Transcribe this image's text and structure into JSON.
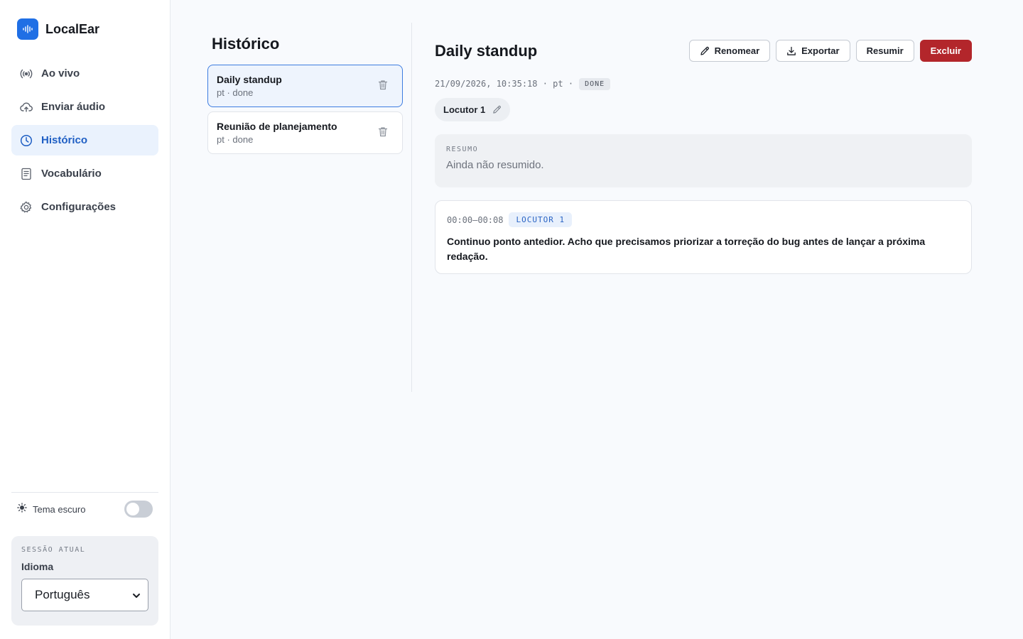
{
  "app": {
    "name": "LocalEar",
    "logo_icon": "waveform-icon",
    "accent": "#1f6fe5"
  },
  "nav": {
    "items": [
      {
        "label": "Ao vivo",
        "icon": "broadcast-icon",
        "active": false
      },
      {
        "label": "Enviar áudio",
        "icon": "cloud-upload-icon",
        "active": false
      },
      {
        "label": "Histórico",
        "icon": "clock-icon",
        "active": true
      },
      {
        "label": "Vocabulário",
        "icon": "book-list-icon",
        "active": false
      },
      {
        "label": "Configurações",
        "icon": "gear-icon",
        "active": false
      }
    ]
  },
  "theme": {
    "label": "Tema escuro",
    "icon": "sun-icon",
    "enabled": false
  },
  "session": {
    "caption": "SESSÃO ATUAL",
    "language_label": "Idioma",
    "language_value": "Português"
  },
  "history": {
    "title": "Histórico",
    "items": [
      {
        "title": "Daily standup",
        "meta": "pt · done",
        "selected": true
      },
      {
        "title": "Reunião de planejamento",
        "meta": "pt · done",
        "selected": false
      }
    ]
  },
  "detail": {
    "title": "Daily standup",
    "buttons": {
      "rename": "Renomear",
      "export": "Exportar",
      "summarize": "Resumir",
      "delete": "Excluir"
    },
    "meta": "21/09/2026, 10:35:18 · pt ·",
    "status": "DONE",
    "speaker_chip": "Locutor 1",
    "summary": {
      "caption": "RESUMO",
      "text": "Ainda não resumido."
    },
    "segments": [
      {
        "time": "00:00–00:08",
        "speaker": "LOCUTOR 1",
        "text": "Continuo ponto antedior. Acho que precisamos priorizar a torreção do bug antes de lançar a próxima redação."
      }
    ]
  },
  "colors": {
    "danger": "#b3262b",
    "active_nav_bg": "#eaf2fd",
    "active_nav_text": "#1f5fc4"
  }
}
